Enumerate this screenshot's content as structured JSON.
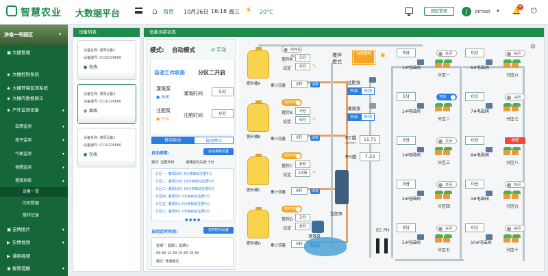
{
  "header": {
    "brand": "智慧农业",
    "platform": "大数据平台",
    "home": "首页",
    "date": "10月26日",
    "time": "16:18",
    "weekday": "周三",
    "temperature": "20°C",
    "park_btn": "园区管理",
    "avatar": "J",
    "user": "jnrtest",
    "caret": "▾",
    "badge": "4"
  },
  "sidebar": {
    "park": "济南一号园区",
    "park_arrow": "▾",
    "items": [
      {
        "label": "大棚管理",
        "level": 0,
        "icon": "▣"
      },
      {
        "label": "大棚控制系统",
        "level": 0,
        "icon": "◈"
      },
      {
        "label": "大棚环境监测系统",
        "level": 0,
        "icon": "◈"
      },
      {
        "label": "大棚内数据展示",
        "level": 0,
        "icon": "◈"
      },
      {
        "label": "户外监测设备",
        "level": 0,
        "icon": "◈",
        "arrow": "▴"
      },
      {
        "label": "虫情监测",
        "level": 1,
        "arrow": "▾"
      },
      {
        "label": "孢子监测",
        "level": 1,
        "arrow": "▾"
      },
      {
        "label": "气象监测",
        "level": 1,
        "arrow": "▾"
      },
      {
        "label": "墒情监测",
        "level": 1,
        "arrow": "▾"
      },
      {
        "label": "灌溉系统",
        "level": 1,
        "arrow": "▴"
      },
      {
        "label": "设备一览",
        "level": 2,
        "active": true
      },
      {
        "label": "历史数据",
        "level": 2
      },
      {
        "label": "操作记录",
        "level": 2
      },
      {
        "label": "苗情图片",
        "level": 0,
        "icon": "▣",
        "arrow": "▾"
      },
      {
        "label": "实情视频",
        "level": 0,
        "icon": "▶",
        "arrow": "▾"
      },
      {
        "label": "通用视频",
        "level": 0,
        "icon": "▶"
      },
      {
        "label": "报警提醒",
        "level": 0,
        "icon": "◉",
        "arrow": "▾"
      }
    ]
  },
  "device_list": {
    "title": "设备列表",
    "cards": [
      {
        "name_label": "设备名称:",
        "name": "灌溉设备1",
        "id_label": "设备编号:",
        "id": "0110226666",
        "status": "在线",
        "color": "#1f8a4c"
      },
      {
        "name_label": "设备名称:",
        "name": "灌溉设备2",
        "id_label": "设备编号:",
        "id": "0110226666",
        "status": "离线",
        "color": "#999999"
      },
      {
        "name_label": "设备名称:",
        "name": "灌溉设备1",
        "id_label": "设备编号:",
        "id": "0110226666",
        "status": "在线",
        "color": "#1f8a4c"
      }
    ]
  },
  "status": {
    "title": "设备当前状态",
    "mode_label": "模式:",
    "mode": "自动模式",
    "manual": "手动",
    "auto_state_label": "自动工作状态",
    "zone_state": "分区二开启",
    "irr_pump": "灌溉泵",
    "irr_pump_state": "关闭",
    "irr_time_label": "灌溉时间",
    "irr_time": "5分",
    "fert_pump": "注肥泵",
    "fert_pump_state": "开启",
    "fert_time_label": "注肥时间",
    "fert_time": "0分",
    "tab_start": "自动启动",
    "tab_stop": "自动停止",
    "param_label": "自动参数:",
    "param_btn": "自动参数设置",
    "param_mode": "模式: 注肥开启",
    "param_interval": "灌溉延时关闭: 5分",
    "zones": [
      "分区一: 灌溉10分  5分钟启动注肥5分",
      "分区二: 灌溉10分  10分钟启动注肥5分",
      "分区三: 灌溉12分  10分钟启动注肥5分",
      "分区四: 灌溉8分  0分钟启动注肥0分",
      "分区五: 灌溉0分  0分钟启动注肥0分",
      "分区六: 灌溉8分  0分钟启动注肥0分"
    ],
    "timer_label": "自动定时时间:",
    "timer_btn": "定时时间设置",
    "timer_days": "星期一  星期二  星期三",
    "timer_times": "09:30   12:30   15:30   19:30",
    "timer_mode": "模式: 普通模式"
  },
  "fert": {
    "tanks": [
      {
        "label": "肥料桶A",
        "tog": "搅拌关闭",
        "on": false,
        "stir_label": "搅拌A",
        "stir": "5分",
        "set_label": "设定",
        "set": "0分",
        "flow_label": "累计流量",
        "flow": "0升",
        "clear": "清零"
      },
      {
        "label": "肥料桶B",
        "tog": "搅拌开启",
        "on": true,
        "stir_label": "搅拌B",
        "stir": "4分",
        "set_label": "设定",
        "set": "6分",
        "flow_label": "累计流量",
        "flow": "0升",
        "clear": "清零"
      },
      {
        "label": "肥料桶C",
        "tog": "搅拌开启",
        "on": true,
        "stir_label": "搅拌C",
        "stir": "8分",
        "set_label": "设定",
        "set": "10分",
        "flow_label": "累计流量",
        "flow": "0升",
        "clear": "清零"
      },
      {
        "label": "肥料桶D",
        "tog": "搅拌开启",
        "on": true,
        "stir_label": "搅拌D",
        "stir": "2分",
        "set_label": "设定",
        "set": "8分",
        "flow_label": "累计流量",
        "flow": "0升",
        "clear": "清零"
      }
    ],
    "mix_label": "搅拌模式",
    "mix_btn": "自动搅拌",
    "inj_pump": "注肥泵",
    "inj_open": "开启",
    "inj_close": "关闭",
    "irr_pump": "灌溉泵",
    "irr_open": "开启",
    "irr_close": "关闭",
    "ec_label": "EC值",
    "ec_unit": "us/cm",
    "ec": "11.71",
    "ph_label": "PH值",
    "ph": "7.23",
    "inj_pump2": "注肥泵",
    "irr_pump2": "灌溉泵",
    "ecph": "EC PH"
  },
  "valves": {
    "left": [
      {
        "val": "0分",
        "tog": "关闭",
        "on": false,
        "name": "1#电磁阀",
        "zone": "分区一"
      },
      {
        "val": "5分",
        "tog": "开启",
        "on": true,
        "name": "2#电磁阀",
        "zone": "分区二"
      },
      {
        "val": "0分",
        "tog": "关闭",
        "on": false,
        "name": "3#电磁阀",
        "zone": "分区三"
      },
      {
        "val": "0分",
        "tog": "关闭",
        "on": false,
        "name": "4#电磁阀",
        "zone": "分区四"
      },
      {
        "val": "0分",
        "tog": "关闭",
        "on": false,
        "name": "5#电磁阀",
        "zone": "分区五"
      }
    ],
    "right": [
      {
        "val": "0分",
        "tog": "关闭",
        "on": false,
        "name": "6#电磁阀",
        "zone": "分区六"
      },
      {
        "val": "0分",
        "tog": "关闭",
        "on": false,
        "name": "7#电磁阀",
        "zone": "分区七"
      },
      {
        "val": "0分",
        "tog": "故障",
        "fault": true,
        "name": "8#电磁阀",
        "zone": "分区八"
      },
      {
        "val": "0分",
        "tog": "关闭",
        "on": false,
        "name": "9#电磁阀",
        "zone": "分区九"
      },
      {
        "val": "0分",
        "tog": "关闭",
        "on": false,
        "name": "10#电磁阀",
        "zone": "分区十"
      }
    ]
  }
}
